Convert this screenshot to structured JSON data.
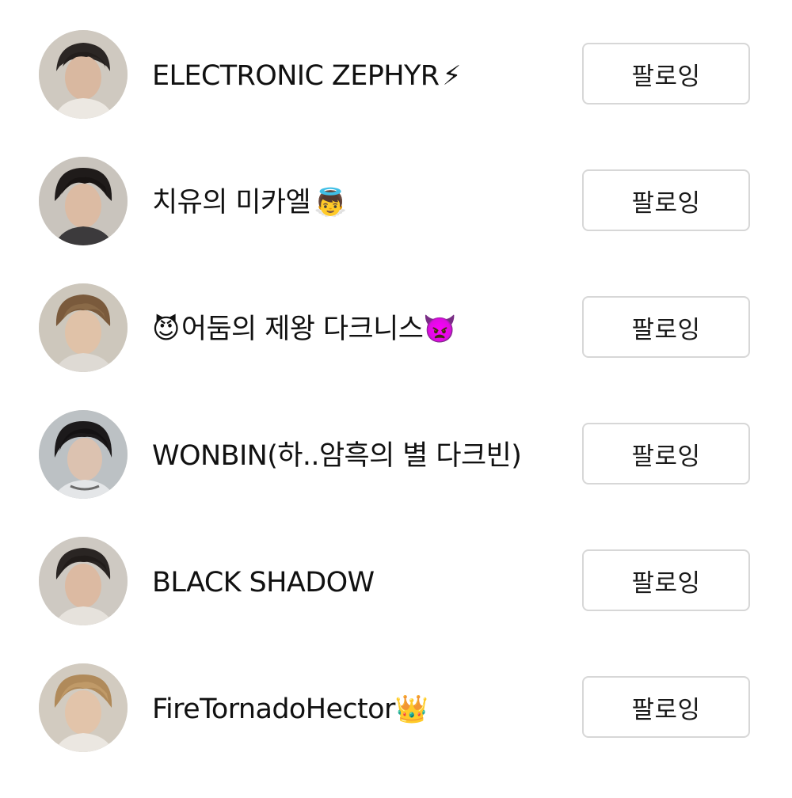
{
  "following_list": {
    "items": [
      {
        "name": "ELECTRONIC ZEPHYR",
        "emoji_after": "⚡",
        "button_label": "팔로잉",
        "avatar_icon": "person-photo-icon"
      },
      {
        "name": "치유의 미카엘",
        "emoji_after": "👼",
        "button_label": "팔로잉",
        "avatar_icon": "person-photo-icon"
      },
      {
        "emoji_before": "😈",
        "name": "어둠의 제왕 다크니스",
        "emoji_after": "👿",
        "button_label": "팔로잉",
        "avatar_icon": "person-photo-icon"
      },
      {
        "name": "WONBIN(하..암흑의 별 다크빈)",
        "button_label": "팔로잉",
        "avatar_icon": "person-photo-icon"
      },
      {
        "name": "BLACK SHADOW",
        "button_label": "팔로잉",
        "avatar_icon": "person-photo-icon"
      },
      {
        "name": "FireTornadoHector",
        "emoji_after": "👑",
        "button_label": "팔로잉",
        "avatar_icon": "person-photo-icon"
      }
    ]
  },
  "colors": {
    "button_border": "#d7d7d7",
    "text": "#111111",
    "background": "#ffffff"
  }
}
